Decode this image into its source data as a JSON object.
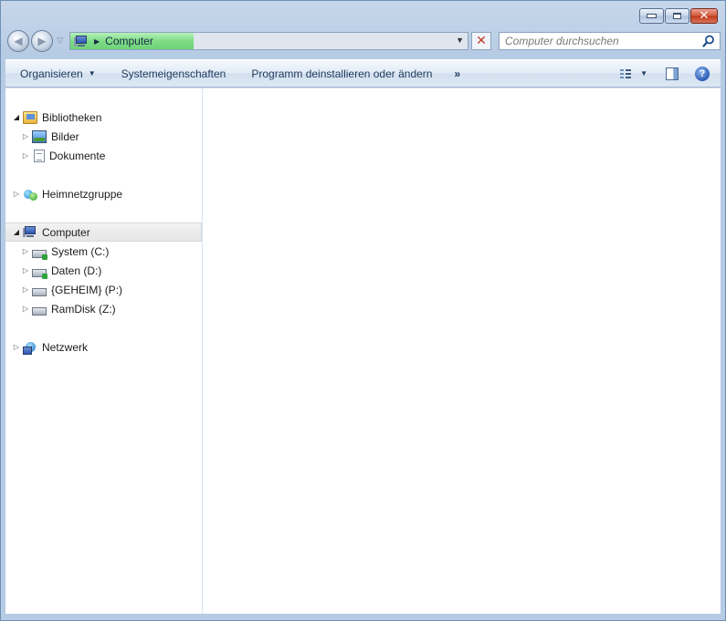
{
  "window": {
    "caption_buttons": {
      "minimize": "minimize",
      "maximize": "maximize",
      "close": "✕"
    }
  },
  "navbar": {
    "back_label": "back",
    "forward_label": "forward",
    "address": {
      "arrow": "▶",
      "text": "Computer",
      "dropdown": "▼",
      "loading_progress": 0.31
    },
    "stop_glyph": "✕",
    "search": {
      "placeholder": "Computer durchsuchen",
      "value": ""
    }
  },
  "command_bar": {
    "organize_label": "Organisieren",
    "organize_arrow": "▼",
    "system_properties_label": "Systemeigenschaften",
    "uninstall_label": "Programm deinstallieren oder ändern",
    "more_label": "»",
    "view_arrow": "▼",
    "help_label": "?"
  },
  "nav_tree": {
    "items": [
      {
        "label": "Bibliotheken",
        "expander": "◢",
        "icon": "library-icon"
      },
      {
        "label": "Bilder",
        "expander": "▷",
        "icon": "pictures-icon"
      },
      {
        "label": "Dokumente",
        "expander": "▷",
        "icon": "documents-icon"
      },
      {
        "label": "Heimnetzgruppe",
        "expander": "▷",
        "icon": "homegroup-icon"
      },
      {
        "label": "Computer",
        "expander": "◢",
        "icon": "computer-icon",
        "selected": true
      },
      {
        "label": "System (C:)",
        "expander": "▷",
        "icon": "drive-icon"
      },
      {
        "label": "Daten (D:)",
        "expander": "▷",
        "icon": "drive-icon"
      },
      {
        "label": "{GEHEIM} (P:)",
        "expander": "▷",
        "icon": "drive-icon"
      },
      {
        "label": "RamDisk (Z:)",
        "expander": "▷",
        "icon": "drive-icon"
      },
      {
        "label": "Netzwerk",
        "expander": "▷",
        "icon": "network-icon"
      }
    ]
  },
  "colors": {
    "chrome": "#c7d7ea",
    "progress": "#7fdc88",
    "close_button": "#c13818",
    "link_text": "#1e395b"
  }
}
